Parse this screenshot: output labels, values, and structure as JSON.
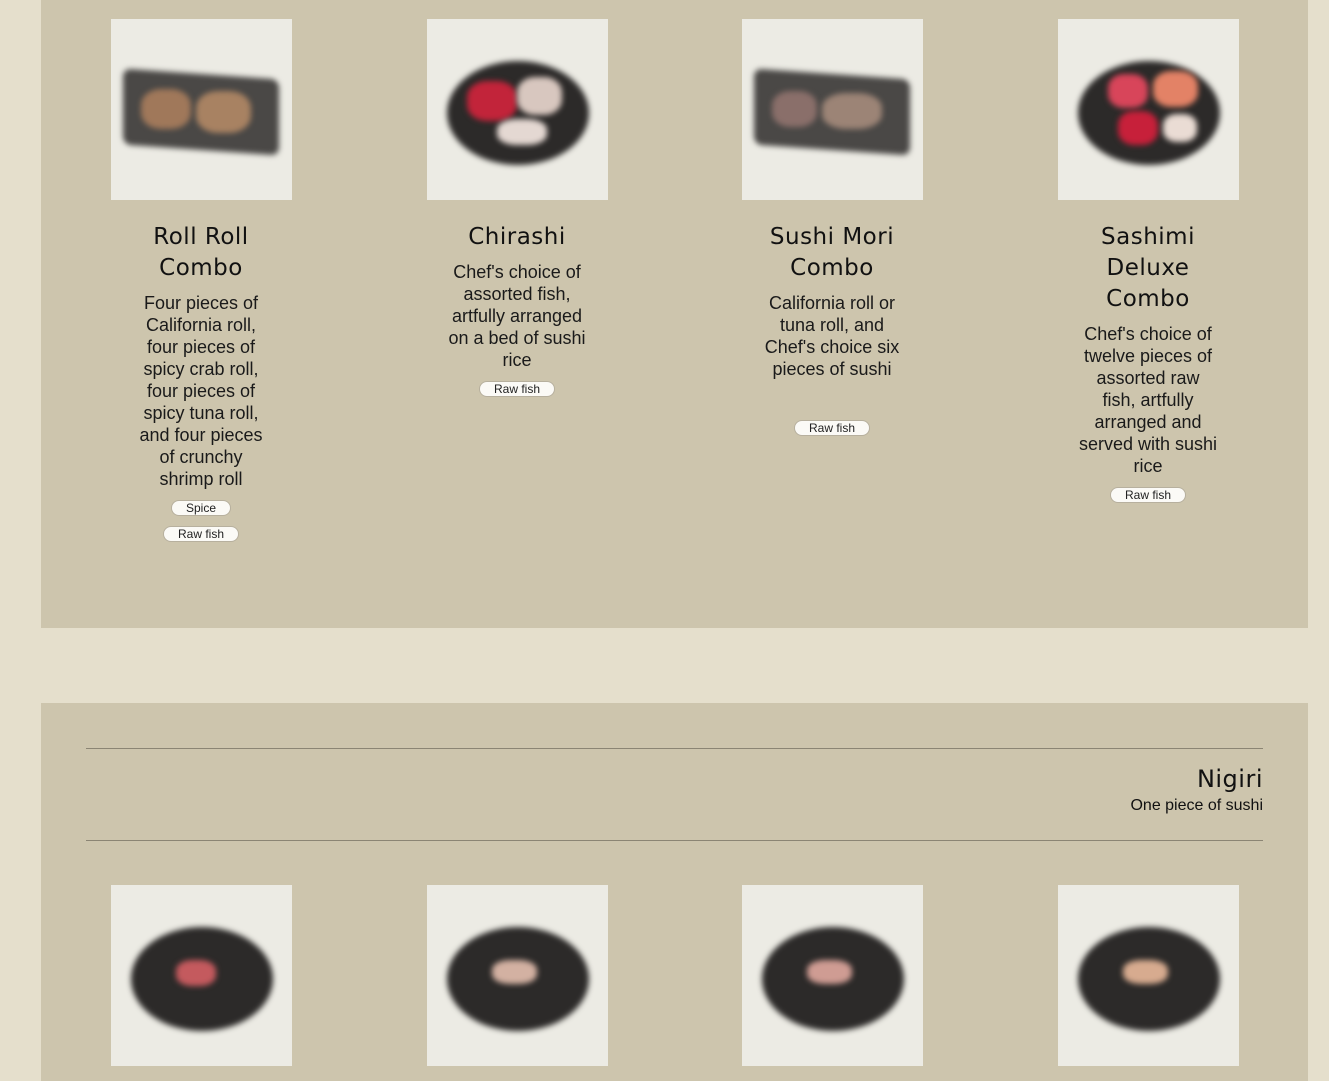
{
  "combos": [
    {
      "name": "Roll Roll Combo",
      "description": "Four pieces of California roll, four pieces of spicy crab roll, four pieces of spicy tuna roll, and four pieces of crunchy shrimp roll",
      "tags": [
        "Spice",
        "Raw fish"
      ],
      "image": "roll-tray-photo"
    },
    {
      "name": "Chirashi",
      "description": "Chef's choice of assorted fish, artfully arranged on a bed of sushi rice",
      "tags": [
        "Raw fish"
      ],
      "image": "chirashi-bowl-photo"
    },
    {
      "name": "Sushi Mori Combo",
      "description": "California roll or tuna roll, and Chef's choice six pieces of sushi",
      "tags": [
        "Raw fish"
      ],
      "image": "sushi-tray-photo"
    },
    {
      "name": "Sashimi Deluxe Combo",
      "description": "Chef's choice of twelve pieces of assorted raw fish, artfully arranged and served with sushi rice",
      "tags": [
        "Raw fish"
      ],
      "image": "sashimi-bowl-photo"
    }
  ],
  "nigiri_section": {
    "title": "Nigiri",
    "subtitle": "One piece of sushi",
    "items": [
      {
        "image": "nigiri-photo-1"
      },
      {
        "image": "nigiri-photo-2"
      },
      {
        "image": "nigiri-photo-3"
      },
      {
        "image": "nigiri-photo-4"
      }
    ]
  }
}
